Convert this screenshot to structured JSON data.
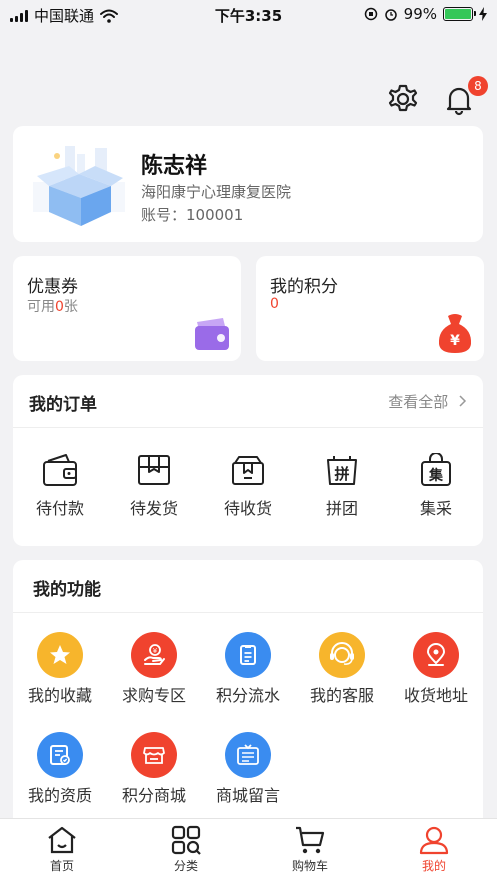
{
  "status_bar": {
    "carrier": "中国联通",
    "time": "下午3:35",
    "battery": "99%"
  },
  "header": {
    "notification_count": "8"
  },
  "profile": {
    "name": "陈志祥",
    "org": "海阳康宁心理康复医院",
    "account": "账号：100001"
  },
  "coupon": {
    "title": "优惠券",
    "prefix": "可用",
    "count": "0",
    "suffix": "张"
  },
  "points": {
    "title": "我的积分",
    "value": "0"
  },
  "orders": {
    "title": "我的订单",
    "view_all": "查看全部",
    "items": [
      {
        "label": "待付款",
        "icon": "wallet-icon"
      },
      {
        "label": "待发货",
        "icon": "box-icon"
      },
      {
        "label": "待收货",
        "icon": "package-icon"
      },
      {
        "label": "拼团",
        "icon": "group-buy-icon",
        "glyph": "拼"
      },
      {
        "label": "集采",
        "icon": "bag-icon",
        "glyph": "集"
      }
    ]
  },
  "functions": {
    "title": "我的功能",
    "items": [
      {
        "label": "我的收藏",
        "icon": "star-icon",
        "color": "#f7b52c"
      },
      {
        "label": "求购专区",
        "icon": "purchase-icon",
        "color": "#f0432e"
      },
      {
        "label": "积分流水",
        "icon": "list-icon",
        "color": "#3a8cf0"
      },
      {
        "label": "我的客服",
        "icon": "headset-icon",
        "color": "#f7b52c"
      },
      {
        "label": "收货地址",
        "icon": "location-icon",
        "color": "#f0432e"
      },
      {
        "label": "我的资质",
        "icon": "certificate-icon",
        "color": "#3a8cf0"
      },
      {
        "label": "积分商城",
        "icon": "store-icon",
        "color": "#f0432e"
      },
      {
        "label": "商城留言",
        "icon": "message-board-icon",
        "color": "#3a8cf0"
      }
    ]
  },
  "tabs": [
    {
      "label": "首页",
      "icon": "home-icon"
    },
    {
      "label": "分类",
      "icon": "category-icon"
    },
    {
      "label": "购物车",
      "icon": "cart-icon"
    },
    {
      "label": "我的",
      "icon": "profile-icon"
    }
  ],
  "colors": {
    "accent": "#f0432e",
    "blue": "#3a8cf0",
    "yellow": "#f7b52c",
    "purple": "#9a6be8"
  }
}
